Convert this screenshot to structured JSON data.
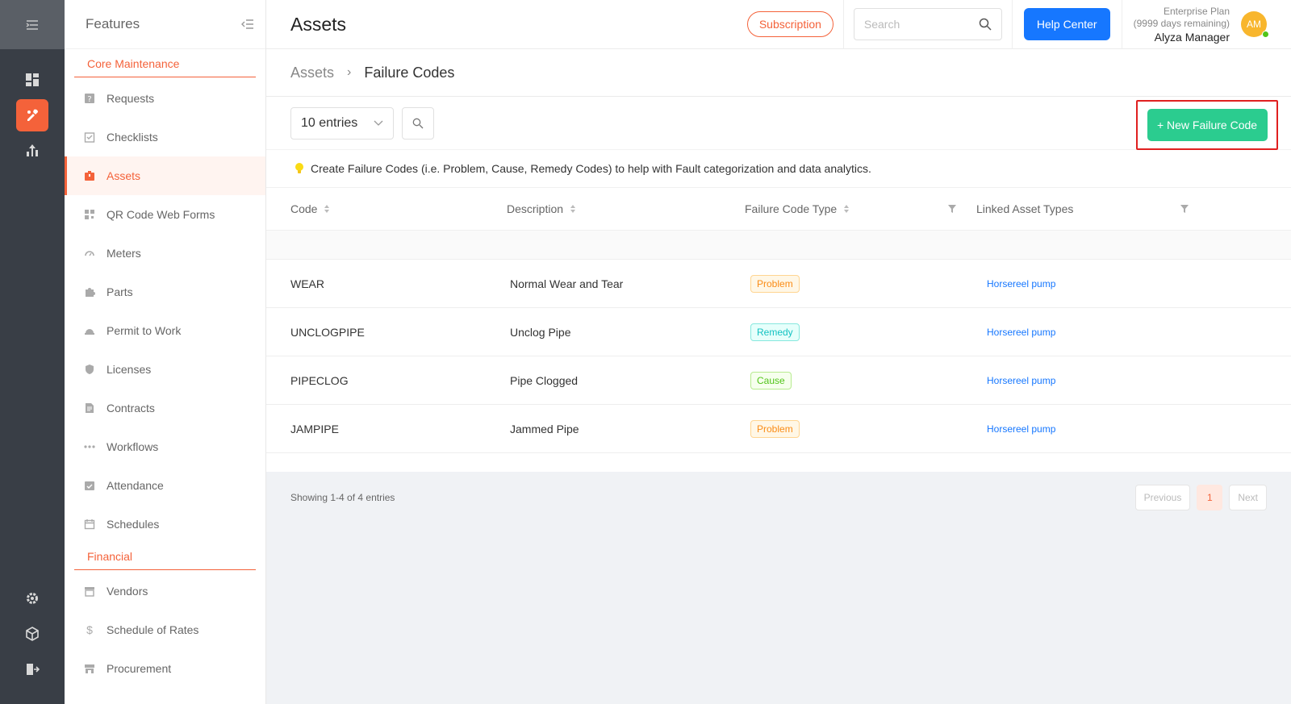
{
  "colors": {
    "accent": "#f4623a",
    "primary": "#1677ff",
    "success": "#2bcc8f",
    "rail": "#393e46"
  },
  "rail": {
    "top_icons": [
      "dashboard-icon",
      "maintenance-icon",
      "analytics-icon"
    ],
    "bottom_icons": [
      "settings-icon",
      "package-icon",
      "logout-icon"
    ]
  },
  "sidebar": {
    "title": "Features",
    "sections": [
      {
        "label": "Core Maintenance"
      },
      {
        "label": "Financial"
      }
    ],
    "items": [
      {
        "label": "Requests",
        "icon": "question-icon"
      },
      {
        "label": "Checklists",
        "icon": "checklist-icon"
      },
      {
        "label": "Assets",
        "icon": "assets-icon"
      },
      {
        "label": "QR Code Web Forms",
        "icon": "qr-code-icon"
      },
      {
        "label": "Meters",
        "icon": "gauge-icon"
      },
      {
        "label": "Parts",
        "icon": "puzzle-icon"
      },
      {
        "label": "Permit to Work",
        "icon": "hardhat-icon"
      },
      {
        "label": "Licenses",
        "icon": "shield-icon"
      },
      {
        "label": "Contracts",
        "icon": "document-icon"
      },
      {
        "label": "Workflows",
        "icon": "workflow-icon"
      },
      {
        "label": "Attendance",
        "icon": "attendance-icon"
      },
      {
        "label": "Schedules",
        "icon": "calendar-icon"
      },
      {
        "label": "Vendors",
        "icon": "store-icon"
      },
      {
        "label": "Schedule of Rates",
        "icon": "dollar-icon"
      },
      {
        "label": "Procurement",
        "icon": "shop-icon"
      }
    ]
  },
  "header": {
    "title": "Assets",
    "subscription_label": "Subscription",
    "search_placeholder": "Search",
    "help_label": "Help Center",
    "plan": "Enterprise Plan",
    "plan_remaining": "(9999 days remaining)",
    "user_name": "Alyza Manager",
    "avatar_initials": "AM"
  },
  "breadcrumb": {
    "parent": "Assets",
    "current": "Failure Codes"
  },
  "toolbar": {
    "entries_select": "10 entries",
    "new_button": "+ New Failure Code"
  },
  "notice": "Create Failure Codes (i.e. Problem, Cause, Remedy Codes) to help with Fault categorization and data analytics.",
  "table": {
    "columns": [
      "Code",
      "Description",
      "Failure Code Type",
      "Linked Asset Types"
    ],
    "rows": [
      {
        "code": "WEAR",
        "description": "Normal Wear and Tear",
        "type": "Problem",
        "linked": "Horsereel pump"
      },
      {
        "code": "UNCLOGPIPE",
        "description": "Unclog Pipe",
        "type": "Remedy",
        "linked": "Horsereel pump"
      },
      {
        "code": "PIPECLOG",
        "description": "Pipe Clogged",
        "type": "Cause",
        "linked": "Horsereel pump"
      },
      {
        "code": "JAMPIPE",
        "description": "Jammed Pipe",
        "type": "Problem",
        "linked": "Horsereel pump"
      }
    ]
  },
  "footer": {
    "showing": "Showing 1-4 of 4 entries",
    "previous": "Previous",
    "page": "1",
    "next": "Next"
  }
}
